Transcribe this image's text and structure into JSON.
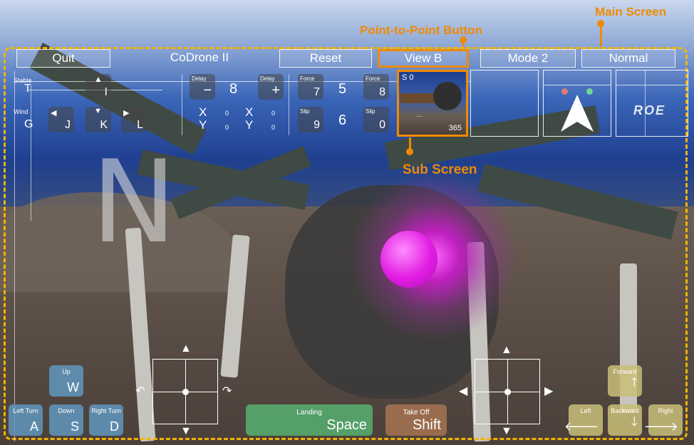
{
  "annotations": {
    "main_screen": "Main Screen",
    "point_to_point": "Point-to-Point Button",
    "sub_screen": "Sub Screen",
    "color": "#f08a00"
  },
  "topbar": {
    "quit": "Quit",
    "title": "CoDrone II",
    "reset": "Reset",
    "view": "View B",
    "mode": "Mode 2",
    "speed": "Normal"
  },
  "hud": {
    "stable_label": "Stable",
    "stable_key": "T",
    "i_key": "I",
    "wind_label": "Wind",
    "wind_key": "G",
    "j_key": "J",
    "k_key": "K",
    "l_key": "L",
    "delay_label": "Delay",
    "delay_minus": "−",
    "delay_value": "8",
    "delay_plus": "+",
    "x_label": "X",
    "y_label": "Y",
    "x_value_1": "0",
    "y_value_1": "0",
    "x_value_2": "0",
    "y_value_2": "0",
    "force_label": "Force",
    "force_key_7": "7",
    "force_value": "5",
    "force_key_8": "8",
    "slip_label": "Slip",
    "slip_key_9": "9",
    "slip_value": "6",
    "slip_key_0": "0",
    "compass_letter": "N"
  },
  "subscreen": {
    "score": "S 0",
    "dots": "....",
    "count": "365"
  },
  "right_panel_text": "ROE",
  "controls": {
    "up_label": "Up",
    "up_key": "W",
    "left_turn_label": "Left Turn",
    "left_turn_key": "A",
    "down_label": "Down",
    "down_key": "S",
    "right_turn_label": "Right Turn",
    "right_turn_key": "D",
    "landing_label": "Landing",
    "landing_key": "Space",
    "takeoff_label": "Take Off",
    "takeoff_key": "Shift",
    "forward_label": "Forward",
    "left_label": "Left",
    "backward_label": "Backward",
    "right_label": "Right"
  }
}
